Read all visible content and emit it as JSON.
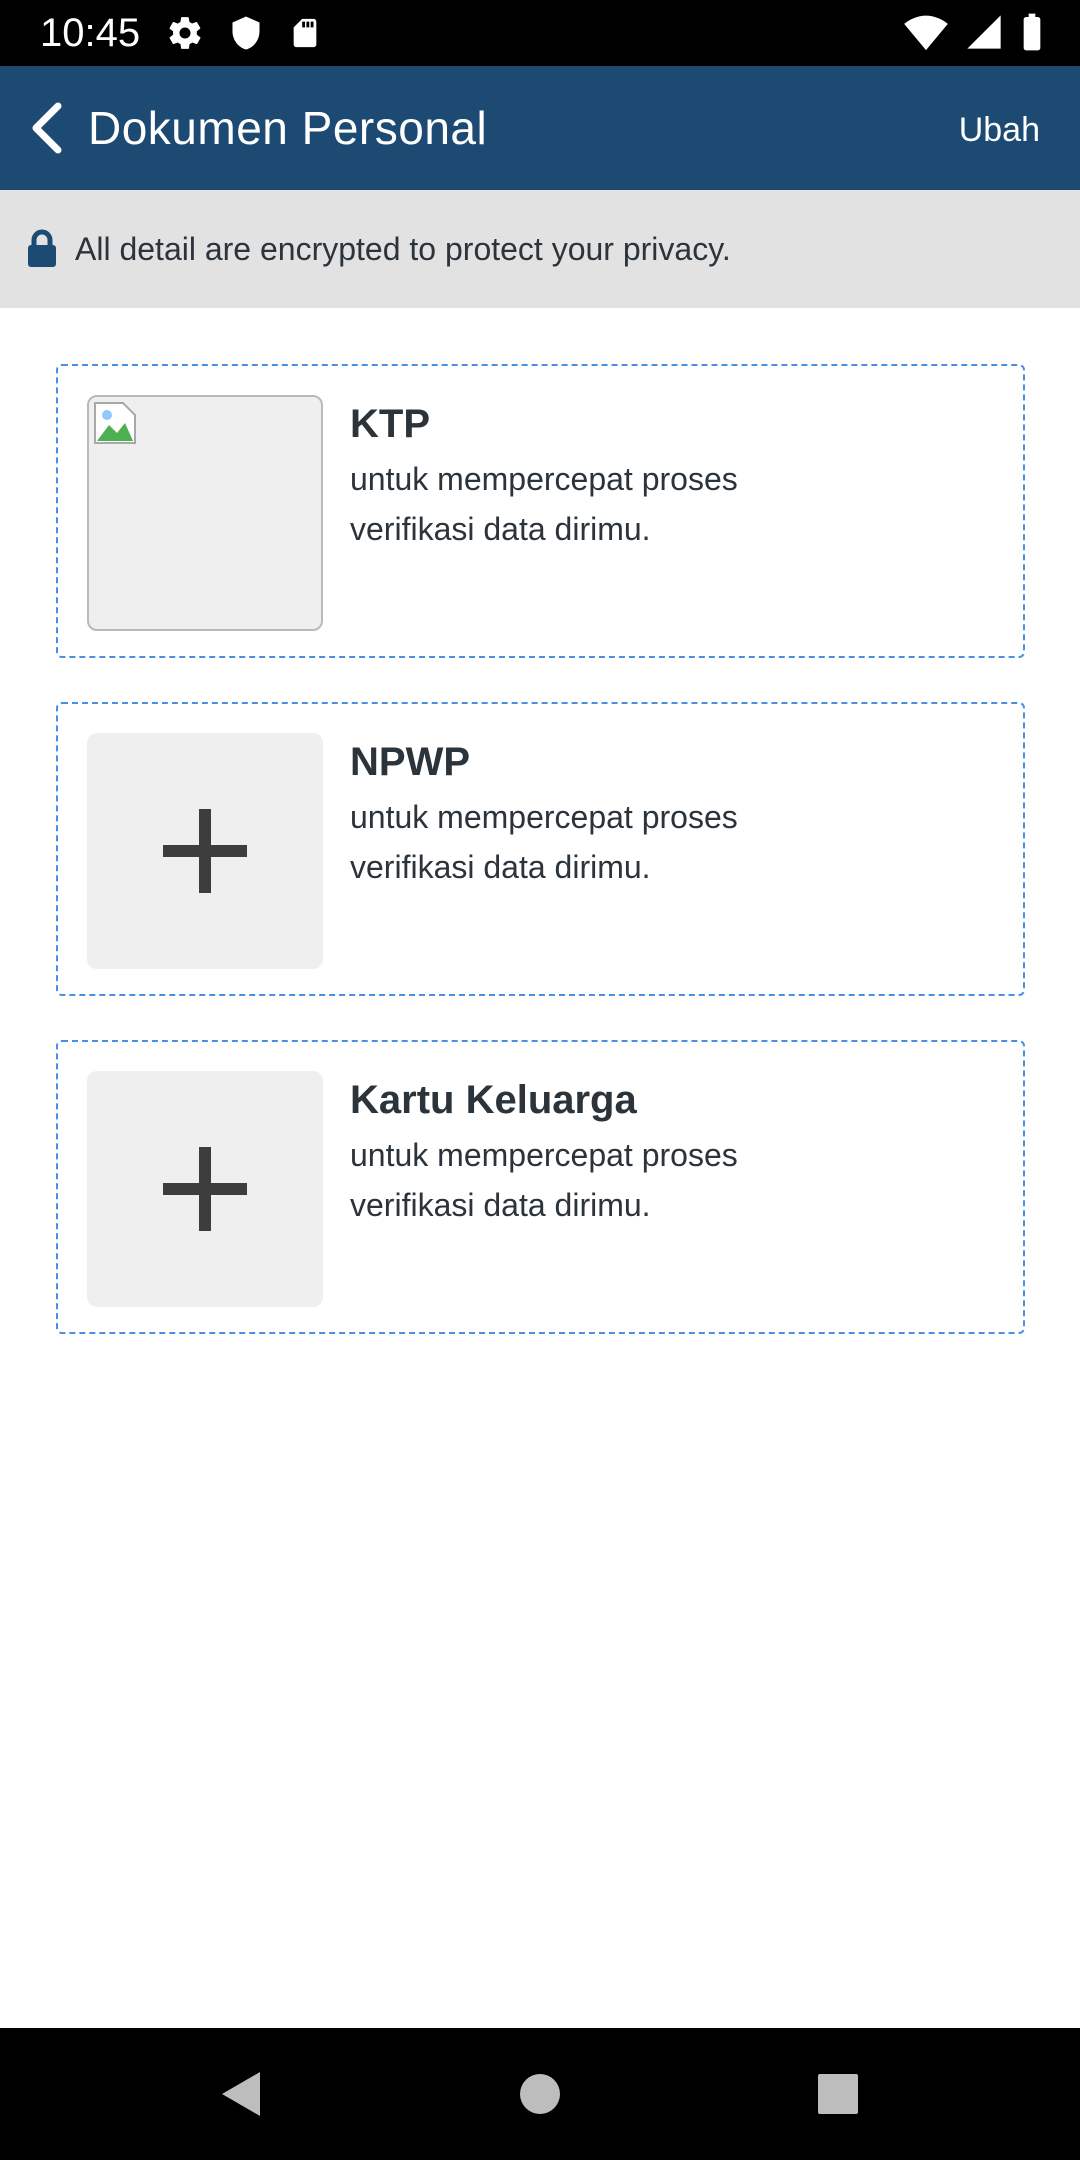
{
  "status_bar": {
    "time": "10:45",
    "left_icons": [
      "gear-icon",
      "shield-icon",
      "sd-card-icon"
    ],
    "right_icons": [
      "wifi-icon",
      "cell-signal-icon",
      "battery-icon"
    ]
  },
  "app_bar": {
    "title": "Dokumen Personal",
    "action_label": "Ubah",
    "background_color": "#1d4a73"
  },
  "privacy_banner": {
    "icon": "lock-icon",
    "text": "All detail are encrypted to protect your privacy."
  },
  "documents": [
    {
      "title": "KTP",
      "description": "untuk mempercepat proses verifikasi data dirimu.",
      "thumbnail": "broken-image-icon"
    },
    {
      "title": "NPWP",
      "description": "untuk mempercepat proses verifikasi data dirimu.",
      "thumbnail": "plus-icon"
    },
    {
      "title": "Kartu Keluarga",
      "description": "untuk mempercepat proses verifikasi data dirimu.",
      "thumbnail": "plus-icon"
    }
  ],
  "colors": {
    "card_border": "#4a90e2",
    "text": "#2b333b"
  },
  "nav_bar": {
    "buttons": [
      "back-triangle-icon",
      "home-circle-icon",
      "recents-square-icon"
    ]
  }
}
